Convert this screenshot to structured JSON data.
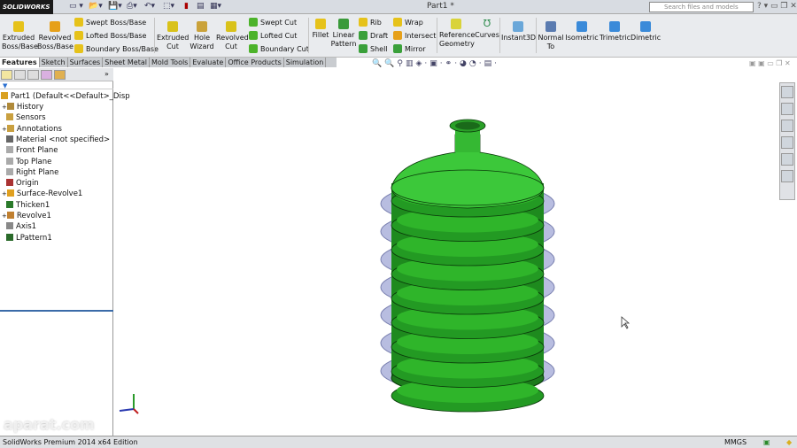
{
  "app": {
    "logo": "SOLIDWORKS",
    "title": "Part1 *",
    "search_placeholder": "Search files and models"
  },
  "ribbon": {
    "extruded_boss": "Extruded Boss/Base",
    "revolved_boss": "Revolved Boss/Base",
    "swept_boss": "Swept Boss/Base",
    "lofted_boss": "Lofted Boss/Base",
    "boundary_boss": "Boundary Boss/Base",
    "extruded_cut": "Extruded Cut",
    "hole_wizard": "Hole Wizard",
    "revolved_cut": "Revolved Cut",
    "swept_cut": "Swept Cut",
    "lofted_cut": "Lofted Cut",
    "boundary_cut": "Boundary Cut",
    "fillet": "Fillet",
    "linear_pattern": "Linear Pattern",
    "rib": "Rib",
    "draft": "Draft",
    "shell": "Shell",
    "wrap": "Wrap",
    "intersect": "Intersect",
    "mirror": "Mirror",
    "reference_geometry": "Reference Geometry",
    "curves": "Curves",
    "instant3d": "Instant3D",
    "normal_to": "Normal To",
    "isometric": "Isometric",
    "trimetric": "Trimetric",
    "dimetric": "Dimetric"
  },
  "tabs": [
    "Features",
    "Sketch",
    "Surfaces",
    "Sheet Metal",
    "Mold Tools",
    "Evaluate",
    "Office Products",
    "Simulation"
  ],
  "tree": {
    "root": "Part1  (Default<<Default>_Disp",
    "items": [
      "History",
      "Sensors",
      "Annotations",
      "Material <not specified>",
      "Front Plane",
      "Top Plane",
      "Right Plane",
      "Origin",
      "Surface-Revolve1",
      "Thicken1",
      "Revolve1",
      "Axis1",
      "LPattern1"
    ]
  },
  "status": {
    "edition": "SolidWorks Premium 2014 x64 Edition",
    "units": "MMGS"
  },
  "watermark": "aparat.com",
  "colors": {
    "model_green": "#2fb52a",
    "rib_surface": "#b8bde0",
    "accent": "#3b6ba8"
  }
}
